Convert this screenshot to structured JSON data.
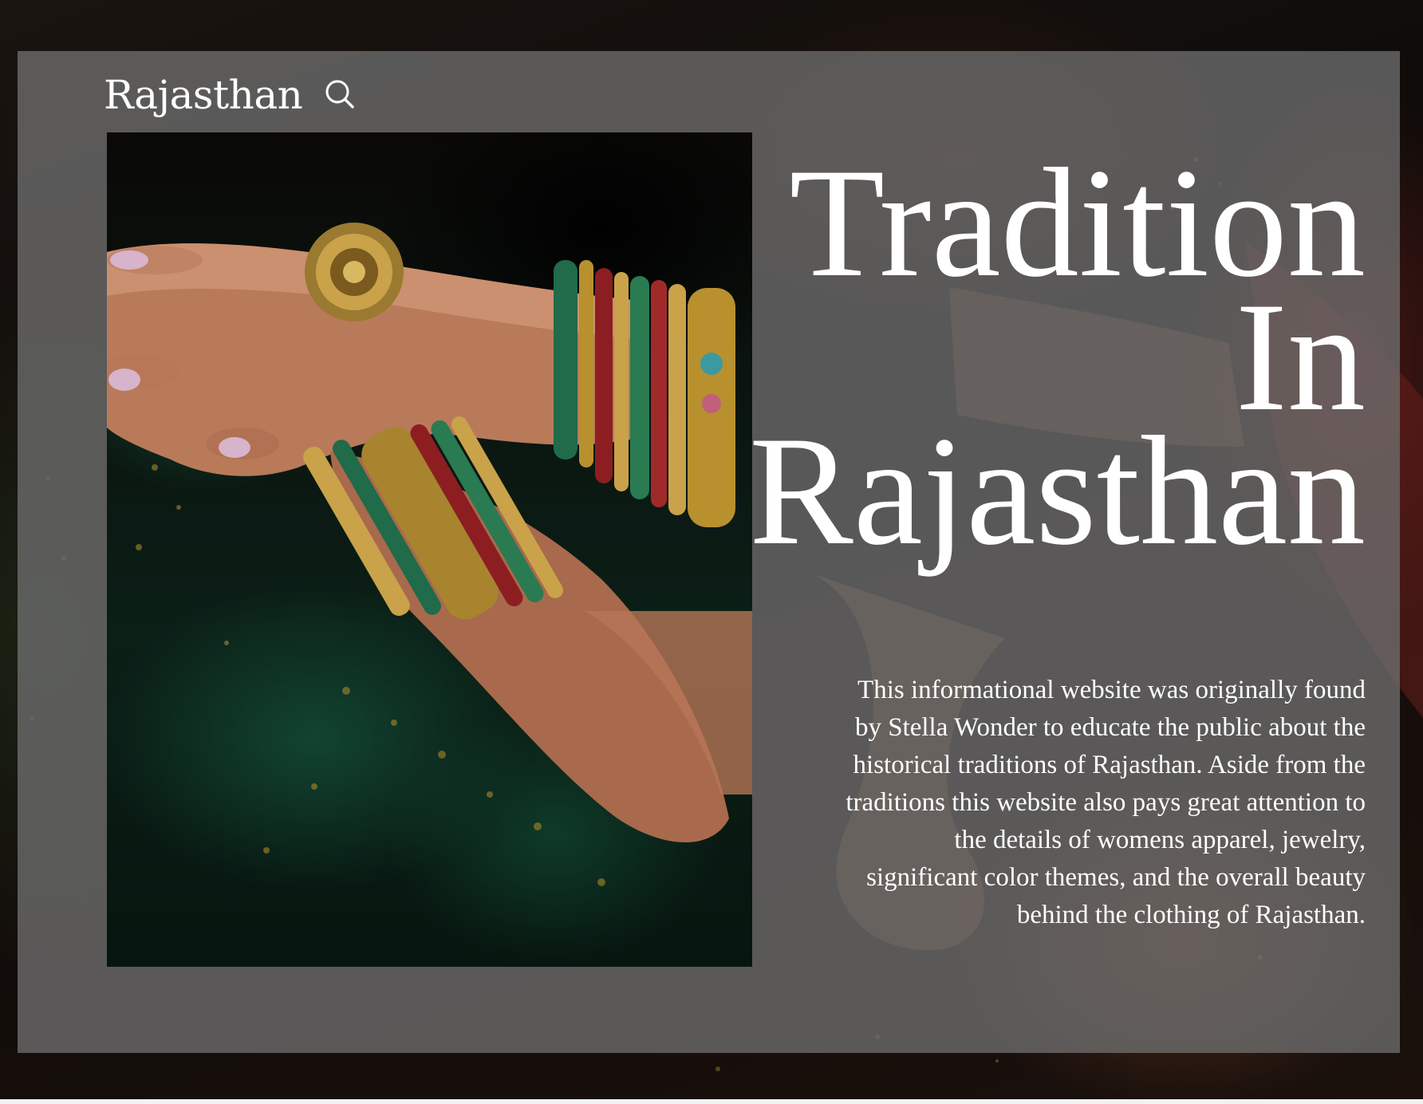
{
  "header": {
    "brand": "Rajasthan",
    "search_icon": "search-icon"
  },
  "hero": {
    "title_lines": [
      "Tradition",
      "In",
      "Rajasthan"
    ]
  },
  "intro": {
    "text": "This informational website was originally found by Stella Wonder to educate the public about the historical traditions of Rajasthan. Aside from the traditions this website also pays great attention to the details of  womens apparel, jewelry, significant color themes, and the overall beauty behind the clothing of Rajasthan."
  },
  "colors": {
    "overlay": "#6e6e6e",
    "text": "#ffffff",
    "accent_green": "#124632",
    "accent_gold": "#b8902e"
  }
}
